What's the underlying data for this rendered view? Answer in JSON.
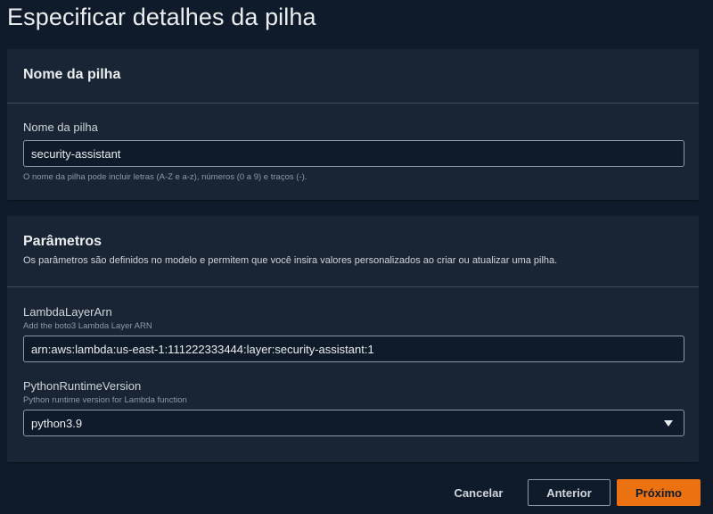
{
  "page": {
    "title": "Especificar detalhes da pilha"
  },
  "stack_name_section": {
    "header": "Nome da pilha",
    "field_label": "Nome da pilha",
    "field_value": "security-assistant",
    "hint": "O nome da pilha pode incluir letras (A-Z e a-z), números (0 a 9) e traços (-)."
  },
  "parameters_section": {
    "header": "Parâmetros",
    "description": "Os parâmetros são definidos no modelo e permitem que você insira valores personalizados ao criar ou atualizar uma pilha.",
    "lambda_layer": {
      "label": "LambdaLayerArn",
      "description": "Add the boto3 Lambda Layer ARN",
      "value": "arn:aws:lambda:us-east-1:111222333444:layer:security-assistant:1"
    },
    "python_runtime": {
      "label": "PythonRuntimeVersion",
      "description": "Python runtime version for Lambda function",
      "selected": "python3.9"
    }
  },
  "footer": {
    "cancel_label": "Cancelar",
    "previous_label": "Anterior",
    "next_label": "Próximo"
  },
  "colors": {
    "background": "#0f1b2a",
    "panel": "#192534",
    "primary_button": "#ec7211",
    "border": "#8d99a8"
  }
}
